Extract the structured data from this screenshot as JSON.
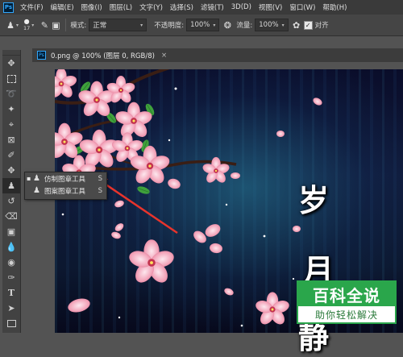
{
  "app": {
    "logo": "Ps"
  },
  "menu": [
    "文件(F)",
    "编辑(E)",
    "图像(I)",
    "图层(L)",
    "文字(Y)",
    "选择(S)",
    "滤镜(T)",
    "3D(D)",
    "视图(V)",
    "窗口(W)",
    "帮助(H)"
  ],
  "options": {
    "brush_size": "17",
    "mode_label": "模式:",
    "mode_value": "正常",
    "opacity_label": "不透明度:",
    "opacity_value": "100%",
    "flow_label": "流量:",
    "flow_value": "100%",
    "align_label": "对齐"
  },
  "document": {
    "tab_title": "0.png @ 100% (图层 0, RGB/8)",
    "close": "×"
  },
  "flyout": {
    "items": [
      {
        "label": "仿制图章工具",
        "shortcut": "S",
        "selected": true
      },
      {
        "label": "图案图章工具",
        "shortcut": "S",
        "selected": false
      }
    ]
  },
  "canvas_text": [
    "岁",
    "月",
    "静"
  ],
  "watermark": {
    "title": "百科全说",
    "subtitle": "助你轻松解决"
  },
  "colors": {
    "accent": "#31a8ff",
    "watermark_green": "#2aa64b",
    "arrow_red": "#e8342c",
    "petal_pink": "#f2a2b8"
  }
}
